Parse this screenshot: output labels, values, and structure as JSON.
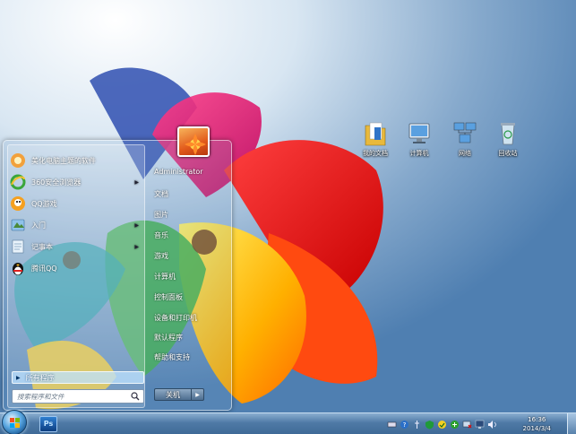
{
  "desktop": {
    "icons": [
      {
        "label": "我的文档",
        "icon": "documents-folder-icon"
      },
      {
        "label": "计算机",
        "icon": "computer-icon"
      },
      {
        "label": "网络",
        "icon": "network-icon"
      },
      {
        "label": "回收站",
        "icon": "recycle-bin-icon"
      }
    ]
  },
  "start_menu": {
    "programs": [
      {
        "label": "美化电脑主题的软件",
        "icon": "theme-app-icon",
        "has_submenu": true
      },
      {
        "label": "360安全浏览器",
        "icon": "ie-browser-icon",
        "has_submenu": true
      },
      {
        "label": "QQ游戏",
        "icon": "qq-game-icon",
        "has_submenu": false
      },
      {
        "label": "入门",
        "icon": "getting-started-icon",
        "has_submenu": true
      },
      {
        "label": "记事本",
        "icon": "notepad-icon",
        "has_submenu": true
      },
      {
        "label": "腾讯QQ",
        "icon": "qq-penguin-icon",
        "has_submenu": false
      }
    ],
    "all_programs": "所有程序",
    "search_placeholder": "搜索程序和文件",
    "user_name": "Administrator",
    "links": [
      "文档",
      "图片",
      "音乐",
      "游戏",
      "计算机",
      "控制面板",
      "设备和打印机",
      "默认程序",
      "帮助和支持"
    ],
    "shutdown_label": "关机"
  },
  "taskbar": {
    "pinned": [
      {
        "label": "Ps",
        "icon": "photoshop-icon"
      }
    ],
    "tray_icons": [
      "keyboard-icon",
      "help-icon",
      "usb-icon",
      "shield-icon",
      "flag-icon",
      "security-icon",
      "network-status-icon",
      "monitor-icon",
      "speaker-icon"
    ],
    "time": "16:36",
    "date": "2014/3/4"
  }
}
